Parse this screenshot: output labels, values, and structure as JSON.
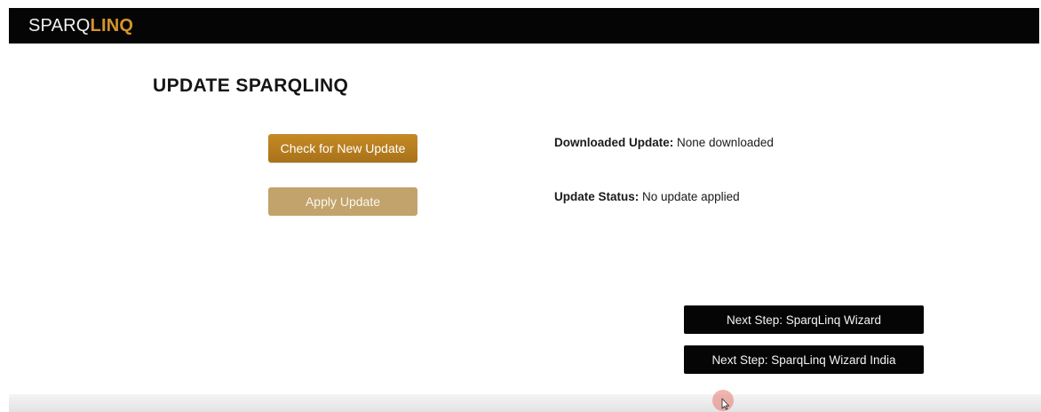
{
  "header": {
    "brand_prefix": "SPARQ",
    "brand_accent": "LINQ",
    "accent_color": "#d6932a"
  },
  "page": {
    "title": "UPDATE SPARQLINQ"
  },
  "actions": {
    "check_label": "Check for New Update",
    "apply_label": "Apply Update"
  },
  "status": {
    "downloaded_label": "Downloaded Update:",
    "downloaded_value": "None downloaded",
    "update_label": "Update Status:",
    "update_value": "No update applied"
  },
  "navigation": {
    "wizard_label": "Next Step: SparqLinq Wizard",
    "wizard_india_label": "Next Step: SparqLinq Wizard India"
  },
  "icons": {
    "cursor": "mouse-pointer-icon"
  }
}
